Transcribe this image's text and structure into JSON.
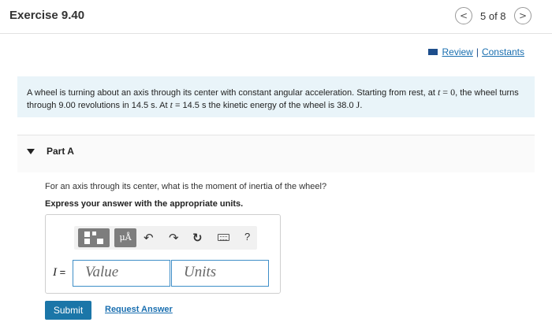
{
  "header": {
    "title": "Exercise 9.40",
    "prev_icon": "<",
    "next_icon": ">",
    "page_count": "5 of 8"
  },
  "links": {
    "review": "Review",
    "separator": "|",
    "constants": "Constants"
  },
  "problem": {
    "seg1": "A wheel is turning about an axis through its center with constant angular acceleration. Starting from rest, at ",
    "var_t1": "t",
    "eq_zero": " = 0",
    "seg2": ", the wheel turns through 9.00 revolutions in 14.5 s. At ",
    "var_t2": "t",
    "seg3": " = 14.5 s the kinetic energy of the wheel is 38.0 ",
    "unit_J": "J",
    "seg4": "."
  },
  "part": {
    "label": "Part A",
    "question": "For an axis through its center, what is the moment of inertia of the wheel?",
    "instruction": "Express your answer with the appropriate units."
  },
  "toolbar": {
    "units_button": "μÅ",
    "undo_icon": "↶",
    "redo_icon": "↷",
    "reset_icon": "↻",
    "help_label": "?"
  },
  "answer": {
    "variable": "I",
    "equals": " =",
    "value_placeholder": "Value",
    "units_placeholder": "Units"
  },
  "actions": {
    "submit": "Submit",
    "request_answer": "Request Answer"
  }
}
